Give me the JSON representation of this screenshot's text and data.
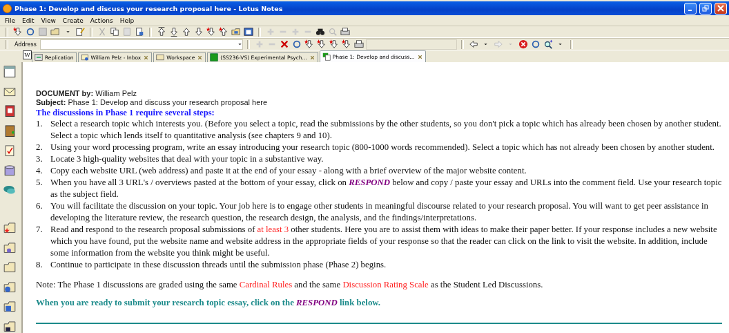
{
  "window": {
    "title": "Phase 1: Develop and discuss your research proposal here - Lotus Notes"
  },
  "menu": [
    {
      "label": "File"
    },
    {
      "label": "Edit"
    },
    {
      "label": "View"
    },
    {
      "label": "Create"
    },
    {
      "label": "Actions"
    },
    {
      "label": "Help"
    }
  ],
  "address_bar": {
    "label": "Address"
  },
  "workspace_badge": "W",
  "tabs": [
    {
      "label": "Replication",
      "selected": false,
      "closable": false,
      "kind": "replication"
    },
    {
      "label": "William Pelz - Inbox",
      "selected": false,
      "closable": true,
      "kind": "inbox"
    },
    {
      "label": "Workspace",
      "selected": false,
      "closable": true,
      "kind": "workspace"
    },
    {
      "label": "(SS236-VS) Experimental Psych...",
      "selected": false,
      "closable": true,
      "kind": "database"
    },
    {
      "label": "Phase 1: Develop and discuss...",
      "selected": true,
      "closable": true,
      "kind": "document"
    }
  ],
  "document": {
    "author_label": "DOCUMENT by:",
    "author": "William Pelz",
    "subject_label": "Subject:",
    "subject": "Phase 1: Develop and discuss your research proposal here",
    "heading": "The discussions in Phase 1 require several steps:",
    "steps": [
      {
        "number": "1.",
        "segments": [
          {
            "kind": "text",
            "text": "Select a research topic which interests you. (Before you select a topic, read the submissions by the other students, so you don't pick a topic which has already been chosen by another student. Select a topic which lends itself to quantitative analysis (see chapters 9 and 10)."
          }
        ]
      },
      {
        "number": "2.",
        "segments": [
          {
            "kind": "text",
            "text": "Using your word processing program, write an essay introducing your research topic (800-1000 words recommended). Select a topic which has not already been chosen by another student."
          }
        ]
      },
      {
        "number": "3.",
        "segments": [
          {
            "kind": "text",
            "text": "Locate 3 high-quality websites that deal with your topic in a substantive way."
          }
        ]
      },
      {
        "number": "4.",
        "segments": [
          {
            "kind": "text",
            "text": "Copy each website URL (web address) and paste it at the end of your essay - along with a brief overview of the major website content."
          }
        ]
      },
      {
        "number": "5.",
        "segments": [
          {
            "kind": "text",
            "text": "When you have all 3 URL's / overviews pasted at the bottom of your essay, click on "
          },
          {
            "kind": "action",
            "text": "RESPOND"
          },
          {
            "kind": "text",
            "text": "  below and copy / paste your essay and URLs into the comment field.  Use your research topic as the subject field."
          }
        ]
      },
      {
        "number": "6.",
        "segments": [
          {
            "kind": "text",
            "text": "You will facilitate the discussion on your topic.  Your job here is to engage other students in meaningful discourse related to your research proposal.  You will want to get peer assistance in developing the literature review, the research question, the research design, the analysis, and the findings/interpretations."
          }
        ]
      },
      {
        "number": "7.",
        "segments": [
          {
            "kind": "text",
            "text": "Read and respond to the research proposal submissions of "
          },
          {
            "kind": "emphasis",
            "text": "at least 3"
          },
          {
            "kind": "text",
            "text": " other students.  Here you are to assist them with ideas to make their paper better.  If your response includes a new website which you have found, put the website name and website address in the appropriate fields of your response so that the reader can click on the link to visit the website. In addition, include some information from the website you think might be useful."
          }
        ]
      },
      {
        "number": "8.",
        "segments": [
          {
            "kind": "text",
            "text": "Continue to participate in these discussion threads until the submission phase (Phase 2) begins."
          }
        ]
      }
    ],
    "note": [
      {
        "kind": "text",
        "text": "Note: The Phase 1 discussions are graded using the same "
      },
      {
        "kind": "link",
        "text": "Cardinal Rules"
      },
      {
        "kind": "text",
        "text": " and the same "
      },
      {
        "kind": "link",
        "text": "Discussion Rating Scale"
      },
      {
        "kind": "text",
        "text": " as the Student Led Discussions."
      }
    ],
    "closing": [
      {
        "kind": "text",
        "text": "When you are ready to submit your research topic essay, click on the "
      },
      {
        "kind": "action",
        "text": "RESPOND"
      },
      {
        "kind": "text",
        "text": "  link below."
      }
    ]
  }
}
